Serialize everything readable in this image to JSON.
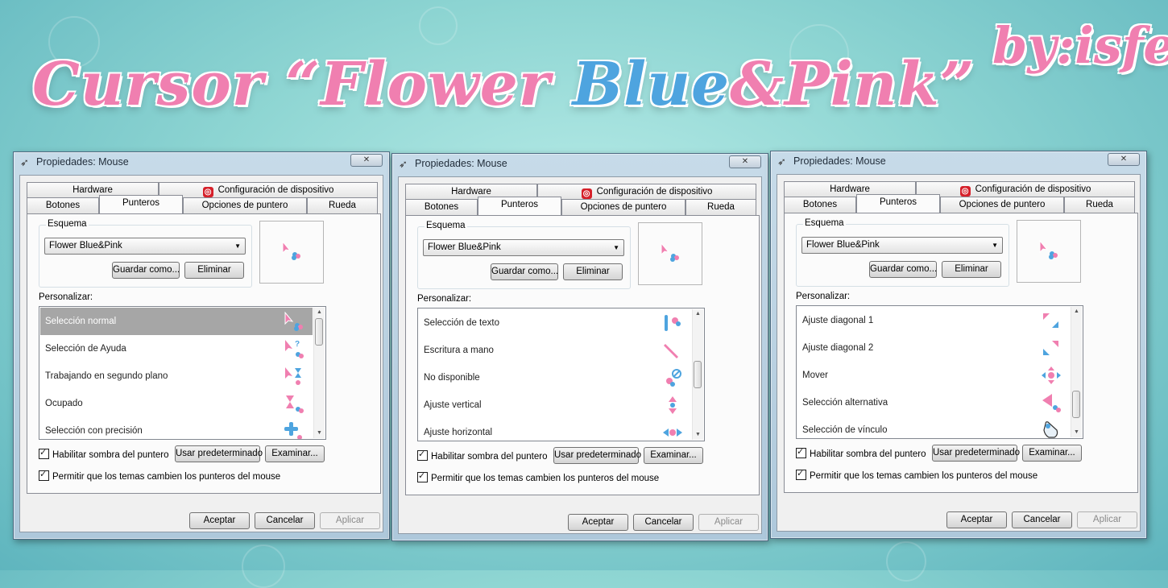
{
  "banner": {
    "title_part1": "Cursor “Flower ",
    "title_blue": "Blue",
    "title_part2": "&Pink”",
    "author": "by:isfe"
  },
  "colors": {
    "pink": "#f07fb0",
    "blue": "#4ea4df",
    "selection": "#a6a6a6"
  },
  "dialogs": [
    {
      "title": "Propiedades: Mouse",
      "close": "✕",
      "tabs_top": [
        "Hardware",
        "Configuración de dispositivo"
      ],
      "tabs_bottom": [
        "Botones",
        "Punteros",
        "Opciones de puntero",
        "Rueda"
      ],
      "selected_tab": "Punteros",
      "scheme_label": "Esquema",
      "scheme_value": "Flower Blue&Pink",
      "save_as": "Guardar como...",
      "delete": "Eliminar",
      "customize_label": "Personalizar:",
      "list": [
        {
          "label": "Selección normal",
          "icon": "arrow-icon",
          "selected": true
        },
        {
          "label": "Selección de Ayuda",
          "icon": "help-icon",
          "selected": false
        },
        {
          "label": "Trabajando en segundo plano",
          "icon": "busy-bg-icon",
          "selected": false
        },
        {
          "label": "Ocupado",
          "icon": "hourglass-icon",
          "selected": false
        },
        {
          "label": "Selección con precisión",
          "icon": "crosshair-icon",
          "selected": false
        }
      ],
      "scroll_thumb": "top",
      "shadow_checkbox": "Habilitar sombra del puntero",
      "use_default": "Usar predeterminado",
      "browse": "Examinar...",
      "themes_checkbox": "Permitir que los temas cambien los punteros del mouse",
      "ok": "Aceptar",
      "cancel": "Cancelar",
      "apply": "Aplicar"
    },
    {
      "title": "Propiedades: Mouse",
      "close": "✕",
      "tabs_top": [
        "Hardware",
        "Configuración de dispositivo"
      ],
      "tabs_bottom": [
        "Botones",
        "Punteros",
        "Opciones de puntero",
        "Rueda"
      ],
      "selected_tab": "Punteros",
      "scheme_label": "Esquema",
      "scheme_value": "Flower Blue&Pink",
      "save_as": "Guardar como...",
      "delete": "Eliminar",
      "customize_label": "Personalizar:",
      "list": [
        {
          "label": "Selección de texto",
          "icon": "text-beam-icon",
          "selected": false
        },
        {
          "label": "Escritura a mano",
          "icon": "pen-icon",
          "selected": false
        },
        {
          "label": "No disponible",
          "icon": "unavailable-icon",
          "selected": false
        },
        {
          "label": "Ajuste vertical",
          "icon": "resize-vertical-icon",
          "selected": false
        },
        {
          "label": "Ajuste horizontal",
          "icon": "resize-horizontal-icon",
          "selected": false
        }
      ],
      "scroll_thumb": "middle",
      "shadow_checkbox": "Habilitar sombra del puntero",
      "use_default": "Usar predeterminado",
      "browse": "Examinar...",
      "themes_checkbox": "Permitir que los temas cambien los punteros del mouse",
      "ok": "Aceptar",
      "cancel": "Cancelar",
      "apply": "Aplicar"
    },
    {
      "title": "Propiedades: Mouse",
      "close": "✕",
      "tabs_top": [
        "Hardware",
        "Configuración de dispositivo"
      ],
      "tabs_bottom": [
        "Botones",
        "Punteros",
        "Opciones de puntero",
        "Rueda"
      ],
      "selected_tab": "Punteros",
      "scheme_label": "Esquema",
      "scheme_value": "Flower Blue&Pink",
      "save_as": "Guardar como...",
      "delete": "Eliminar",
      "customize_label": "Personalizar:",
      "list": [
        {
          "label": "Ajuste diagonal 1",
          "icon": "resize-diagonal1-icon",
          "selected": false
        },
        {
          "label": "Ajuste diagonal 2",
          "icon": "resize-diagonal2-icon",
          "selected": false
        },
        {
          "label": "Mover",
          "icon": "move-icon",
          "selected": false
        },
        {
          "label": "Selección alternativa",
          "icon": "alternate-icon",
          "selected": false
        },
        {
          "label": "Selección de vínculo",
          "icon": "hand-link-icon",
          "selected": false
        }
      ],
      "scroll_thumb": "bottom",
      "shadow_checkbox": "Habilitar sombra del puntero",
      "use_default": "Usar predeterminado",
      "browse": "Examinar...",
      "themes_checkbox": "Permitir que los temas cambien los punteros del mouse",
      "ok": "Aceptar",
      "cancel": "Cancelar",
      "apply": "Aplicar"
    }
  ]
}
